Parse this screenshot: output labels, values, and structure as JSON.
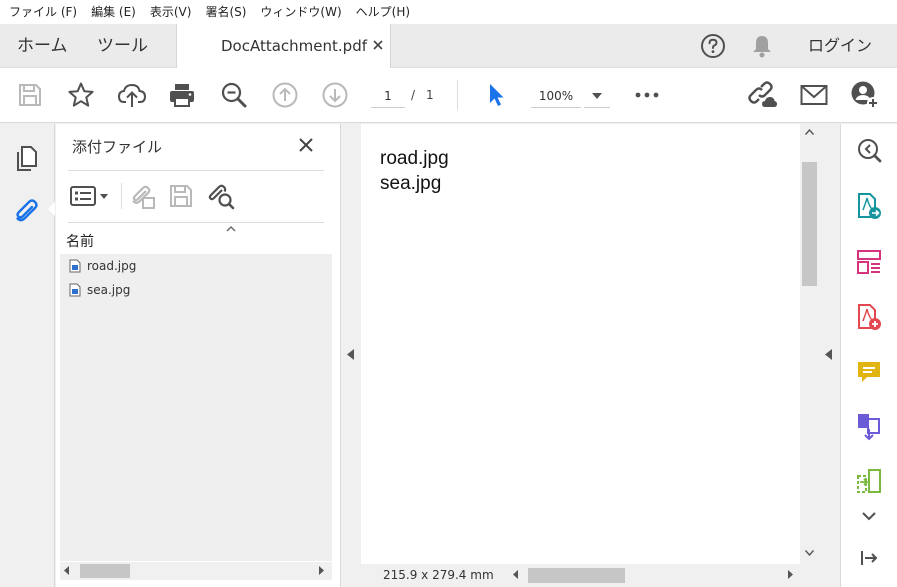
{
  "menu": [
    "ファイル (F)",
    "編集 (E)",
    "表示(V)",
    "署名(S)",
    "ウィンドウ(W)",
    "ヘルプ(H)"
  ],
  "tabs": {
    "home": "ホーム",
    "tools": "ツール",
    "document": "DocAttachment.pdf",
    "close_glyph": "✕",
    "login": "ログイン"
  },
  "toolbar": {
    "page_current": "1",
    "page_sep": "/",
    "page_total": "1",
    "zoom": "100%"
  },
  "attachments_panel": {
    "title": "添付ファイル",
    "column_header": "名前",
    "files": [
      {
        "name": "road.jpg"
      },
      {
        "name": "sea.jpg"
      }
    ]
  },
  "document": {
    "lines": [
      "road.jpg",
      "sea.jpg"
    ],
    "page_size": "215.9 x 279.4 mm"
  },
  "colors": {
    "accent_blue": "#1a73e8",
    "icon_gray": "#505050",
    "disabled_gray": "#b9b9b9",
    "teal": "#17959e",
    "pink": "#d6337f",
    "red": "#e34850",
    "yellow": "#e0b412",
    "purple": "#6b5bd6",
    "green": "#7ab83f"
  },
  "icons": [
    "save-icon",
    "star-icon",
    "cloud-upload-icon",
    "print-icon",
    "zoom-out-icon",
    "page-up-icon",
    "page-down-icon",
    "select-cursor-icon",
    "more-icon",
    "share-link-icon",
    "mail-icon",
    "add-user-icon",
    "help-icon",
    "bell-icon",
    "pages-icon",
    "paperclip-icon"
  ]
}
